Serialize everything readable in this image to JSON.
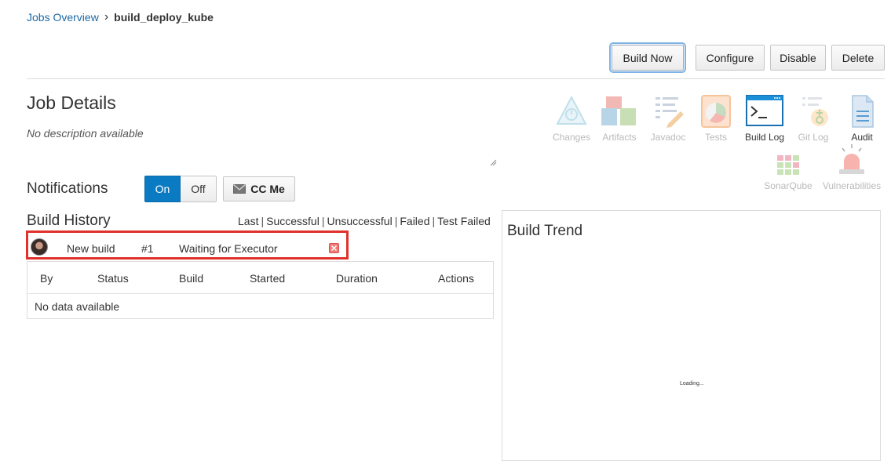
{
  "breadcrumb": {
    "parent": "Jobs Overview",
    "separator": "›",
    "current": "build_deploy_kube"
  },
  "toolbar": {
    "build_now": "Build Now",
    "configure": "Configure",
    "disable": "Disable",
    "delete": "Delete"
  },
  "job": {
    "title": "Job Details",
    "description": "No description available"
  },
  "tools": [
    {
      "label": "Changes",
      "icon": "changes-icon"
    },
    {
      "label": "Artifacts",
      "icon": "artifacts-icon"
    },
    {
      "label": "Javadoc",
      "icon": "javadoc-icon"
    },
    {
      "label": "Tests",
      "icon": "tests-icon"
    },
    {
      "label": "Build Log",
      "icon": "build-log-icon"
    },
    {
      "label": "Git Log",
      "icon": "git-log-icon"
    },
    {
      "label": "Audit",
      "icon": "audit-icon"
    },
    {
      "label": "SonarQube",
      "icon": "sonarqube-icon"
    },
    {
      "label": "Vulnerabilities",
      "icon": "vulnerabilities-icon"
    }
  ],
  "notifications": {
    "title": "Notifications",
    "on": "On",
    "off": "Off",
    "cc_me": "CC Me",
    "state": "On"
  },
  "history": {
    "title": "Build History",
    "filters": [
      "Last",
      "Successful",
      "Unsuccessful",
      "Failed",
      "Test Failed"
    ],
    "queued": {
      "label": "New build",
      "number": "#1",
      "status": "Waiting for Executor"
    },
    "columns": [
      "By",
      "Status",
      "Build",
      "Started",
      "Duration",
      "Actions"
    ],
    "empty": "No data available"
  },
  "trend": {
    "title": "Build Trend",
    "loading": "Loading..."
  },
  "colors": {
    "accent": "#0a7bc2",
    "highlight": "#e0312b",
    "link": "#1f6aa5"
  }
}
